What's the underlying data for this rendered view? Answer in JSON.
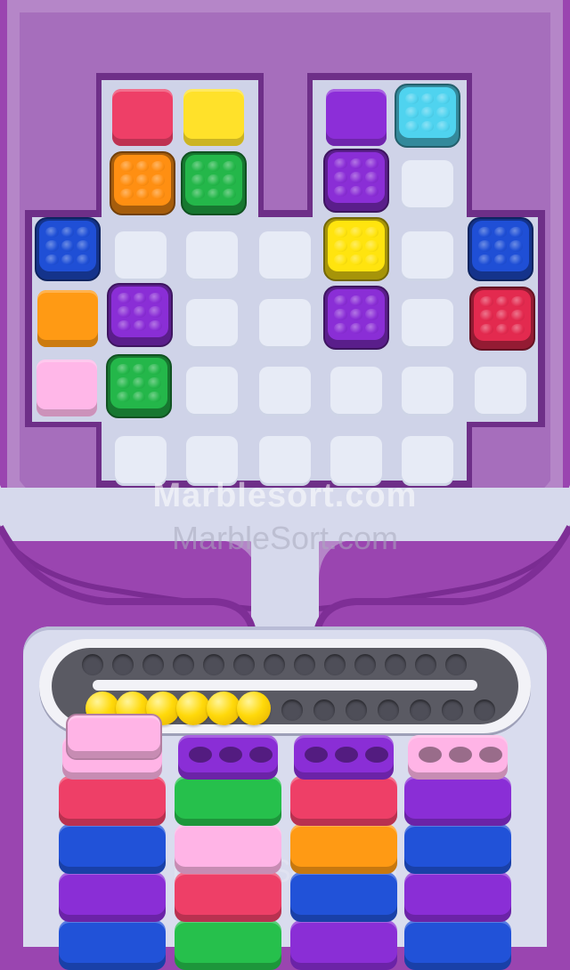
{
  "watermarks": {
    "primary": "Marblesort.com",
    "secondary": "MarbleSort.com"
  },
  "colors": {
    "board_frame": "#b586c8",
    "board_inner": "#a670bd",
    "board_floor": "#cbd0e6",
    "cell": "#e7ebf6",
    "purple_bg": "#9a45b0",
    "track": "#5a5a63",
    "marble": "#ffd90a"
  },
  "board": {
    "blocks": [
      {
        "name": "red-solid-block",
        "color": "#ee3f67",
        "studded": false
      },
      {
        "name": "yellow-solid-block",
        "color": "#ffe12a",
        "studded": false
      },
      {
        "name": "orange-studded-block",
        "color": "#ff8f12",
        "studded": true
      },
      {
        "name": "green-studded-block-top",
        "color": "#24b74a",
        "studded": true
      },
      {
        "name": "purple-solid-block-top",
        "color": "#8c2ed8",
        "studded": false
      },
      {
        "name": "cyan-studded-block",
        "color": "#4fd3ef",
        "studded": true
      },
      {
        "name": "purple-studded-block-a",
        "color": "#8a2ed6",
        "studded": true
      },
      {
        "name": "blue-studded-block-left",
        "color": "#1f4fd6",
        "studded": true
      },
      {
        "name": "yellow-studded-block",
        "color": "#ffe40e",
        "studded": true
      },
      {
        "name": "blue-studded-block-right",
        "color": "#1f4fd6",
        "studded": true
      },
      {
        "name": "orange-solid-block",
        "color": "#ff9a14",
        "studded": false
      },
      {
        "name": "purple-studded-block-b",
        "color": "#8a2ed6",
        "studded": true
      },
      {
        "name": "purple-studded-block-c",
        "color": "#8a2ed6",
        "studded": true
      },
      {
        "name": "red-studded-block",
        "color": "#e32a4f",
        "studded": true
      },
      {
        "name": "pink-solid-block",
        "color": "#ffb7e8",
        "studded": false
      },
      {
        "name": "green-studded-block-bottom",
        "color": "#24b74a",
        "studded": true
      }
    ]
  },
  "conveyor": {
    "marble_count": 6
  },
  "trays": {
    "columns": [
      {
        "name": "tray-column-1",
        "top": "#ffb4e6",
        "rows": [
          "#ee3f67",
          "#2152d8",
          "#8a2ed6",
          "#2152d8"
        ]
      },
      {
        "name": "tray-column-2",
        "top": "#8a2ed6",
        "rows": [
          "#26c04c",
          "#ffb4e6",
          "#ee3f67",
          "#26c04c"
        ]
      },
      {
        "name": "tray-column-3",
        "top": "#8a2ed6",
        "rows": [
          "#ee3f67",
          "#ff9a14",
          "#2152d8",
          "#8a2ed6"
        ]
      },
      {
        "name": "tray-column-4",
        "top": "#ffb4e6",
        "rows": [
          "#8a2ed6",
          "#2152d8",
          "#8a2ed6",
          "#2152d8"
        ]
      }
    ]
  }
}
